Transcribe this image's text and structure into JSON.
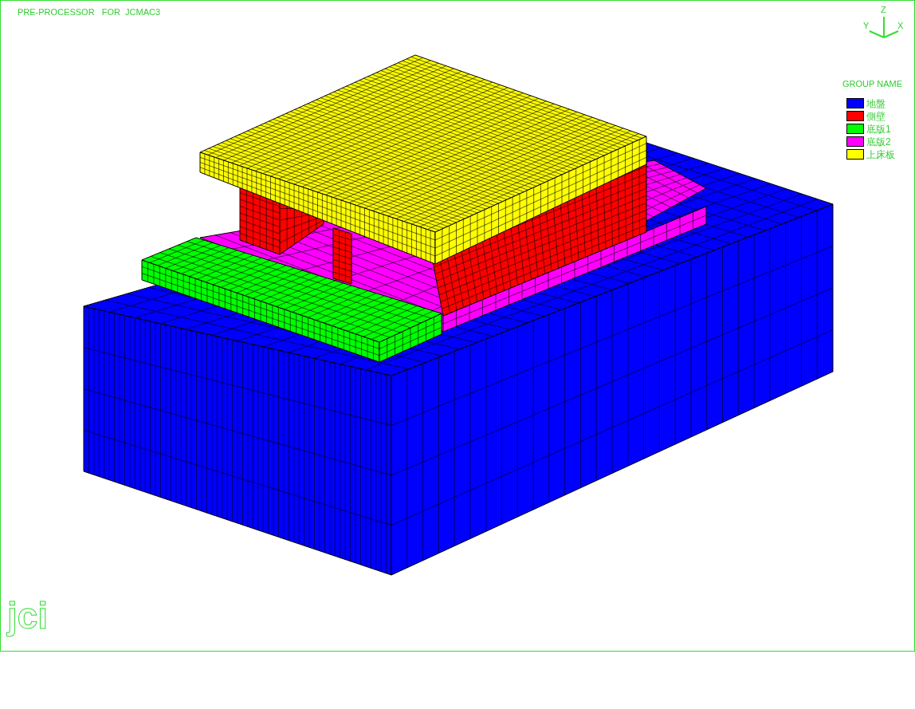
{
  "title": "PRE-PROCESSOR   FOR  JCMAC3",
  "axes": {
    "z": "Z",
    "y": "Y",
    "x": "X"
  },
  "legend": {
    "title": "GROUP NAME",
    "groups": [
      {
        "label": "地盤",
        "color": "#0000ff"
      },
      {
        "label": "側壁",
        "color": "#ff0000"
      },
      {
        "label": "底版1",
        "color": "#00ff00"
      },
      {
        "label": "底版2",
        "color": "#ff00ff"
      },
      {
        "label": "上床板",
        "color": "#ffff00"
      }
    ]
  },
  "logo": "jci"
}
